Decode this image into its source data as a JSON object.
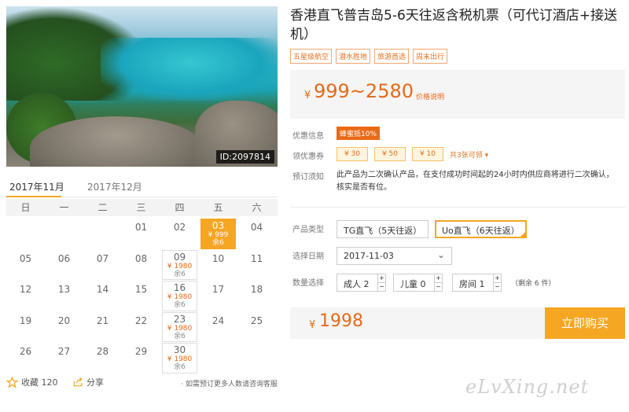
{
  "product": {
    "title": "香港直飞普吉岛5-6天往返含税机票（可代订酒店+接送机）",
    "tags": [
      "五星级航空",
      "潜水胜地",
      "旅游首选",
      "周末出行"
    ],
    "photo_id": "ID:2097814"
  },
  "price": {
    "currency": "¥",
    "range": "999~2580",
    "note": "价格说明"
  },
  "promo": {
    "label": "优惠信息",
    "badge": "蜂蜜抵10%"
  },
  "coupons": {
    "label": "领优惠券",
    "items": [
      "¥ 30",
      "¥ 50",
      "¥ 10"
    ],
    "more": "共3张可领 ▾"
  },
  "booking_notice": {
    "label": "预订须知",
    "text": "此产品为二次确认产品，在支付成功时间起的24小时内供应商将进行二次确认，核实是否有位。"
  },
  "calendar": {
    "tabs": [
      "2017年11月",
      "2017年12月"
    ],
    "weekdays": [
      "日",
      "一",
      "二",
      "三",
      "四",
      "五",
      "六"
    ],
    "days": [
      {
        "n": "",
        "p": "",
        "q": ""
      },
      {
        "n": "",
        "p": "",
        "q": ""
      },
      {
        "n": "",
        "p": "",
        "q": ""
      },
      {
        "n": "01",
        "p": "",
        "q": ""
      },
      {
        "n": "02",
        "p": "",
        "q": ""
      },
      {
        "n": "03",
        "p": "¥ 999",
        "q": "余6",
        "selected": true
      },
      {
        "n": "04",
        "p": "",
        "q": ""
      },
      {
        "n": "05",
        "p": "",
        "q": ""
      },
      {
        "n": "06",
        "p": "",
        "q": ""
      },
      {
        "n": "07",
        "p": "",
        "q": ""
      },
      {
        "n": "08",
        "p": "",
        "q": ""
      },
      {
        "n": "09",
        "p": "¥ 1980",
        "q": "余6"
      },
      {
        "n": "10",
        "p": "",
        "q": ""
      },
      {
        "n": "11",
        "p": "",
        "q": ""
      },
      {
        "n": "12",
        "p": "",
        "q": ""
      },
      {
        "n": "13",
        "p": "",
        "q": ""
      },
      {
        "n": "14",
        "p": "",
        "q": ""
      },
      {
        "n": "15",
        "p": "",
        "q": ""
      },
      {
        "n": "16",
        "p": "¥ 1980",
        "q": "余6"
      },
      {
        "n": "17",
        "p": "",
        "q": ""
      },
      {
        "n": "18",
        "p": "",
        "q": ""
      },
      {
        "n": "19",
        "p": "",
        "q": ""
      },
      {
        "n": "20",
        "p": "",
        "q": ""
      },
      {
        "n": "21",
        "p": "",
        "q": ""
      },
      {
        "n": "22",
        "p": "",
        "q": ""
      },
      {
        "n": "23",
        "p": "¥ 1980",
        "q": "余6"
      },
      {
        "n": "24",
        "p": "",
        "q": ""
      },
      {
        "n": "25",
        "p": "",
        "q": ""
      },
      {
        "n": "26",
        "p": "",
        "q": ""
      },
      {
        "n": "27",
        "p": "",
        "q": ""
      },
      {
        "n": "28",
        "p": "",
        "q": ""
      },
      {
        "n": "29",
        "p": "",
        "q": ""
      },
      {
        "n": "30",
        "p": "¥ 1980",
        "q": "余6"
      }
    ]
  },
  "options": {
    "type_label": "产品类型",
    "types": [
      "TG直飞（5天往返）",
      "Uo直飞（6天往返）"
    ],
    "date_label": "选择日期",
    "date_value": "2017-11-03",
    "qty_label": "数量选择",
    "adult": "成人  2",
    "child": "儿童  0",
    "room": "房间  1",
    "remain": "（剩余 6 件）"
  },
  "checkout": {
    "currency": "¥",
    "total": "1998",
    "buy_label": "立即购买"
  },
  "footer": {
    "fav_label": "收藏 120",
    "share_label": "分享",
    "consult": "· 如需预订更多人数请咨询客服"
  },
  "watermark": "eLvXing.net",
  "colors": {
    "accent": "#f5a623",
    "price": "#e36a1a"
  }
}
